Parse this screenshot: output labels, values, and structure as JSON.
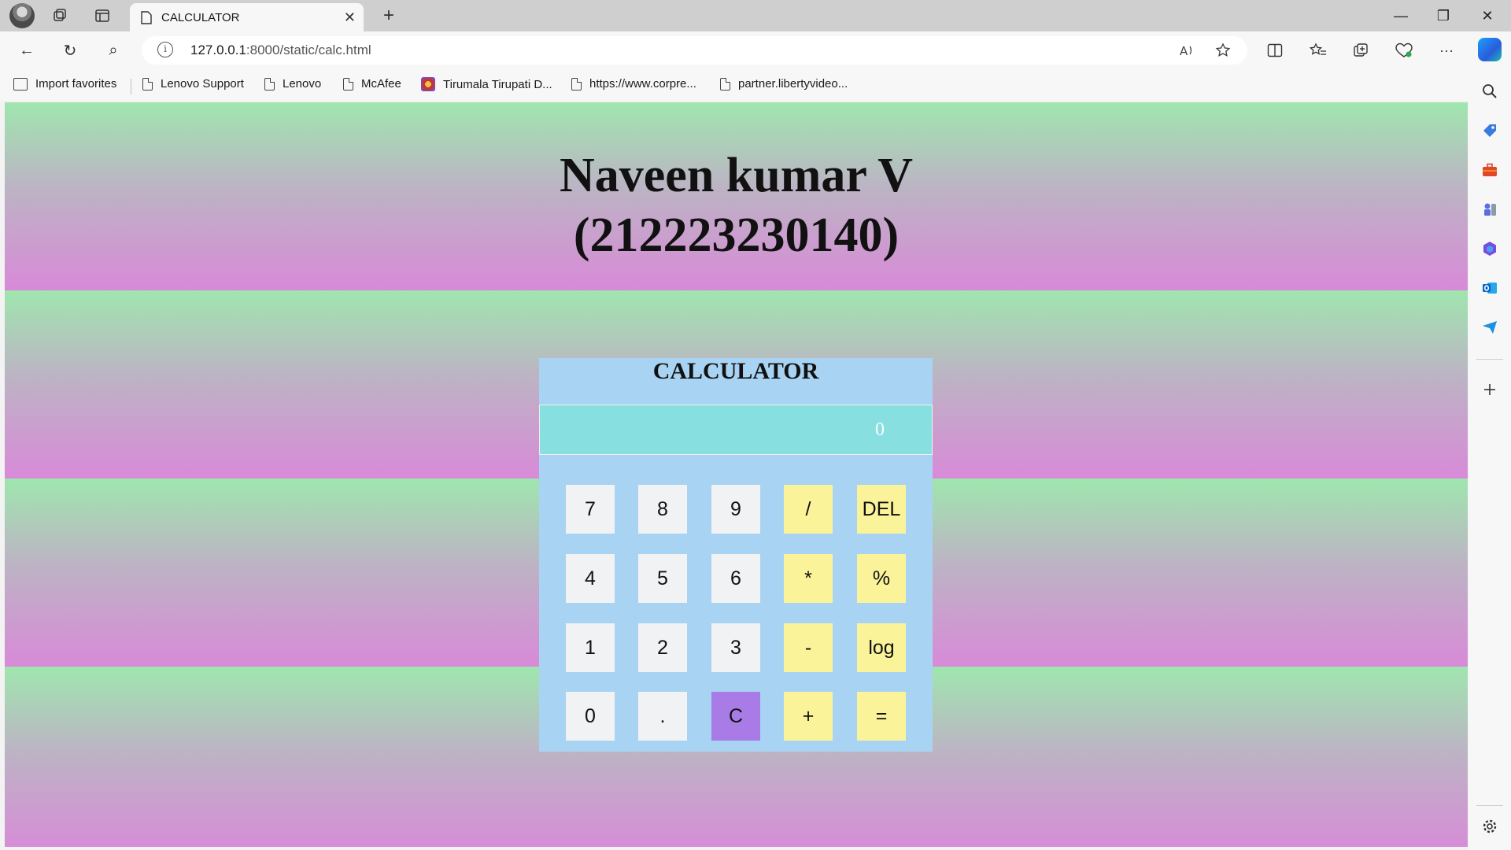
{
  "browser": {
    "tab_title": "CALCULATOR",
    "tab_close": "✕",
    "new_tab": "+",
    "url_host": "127.0.0.1",
    "url_rest": ":8000/static/calc.html",
    "minimize": "—",
    "restore": "❐",
    "close": "✕",
    "back": "←",
    "refresh": "↻",
    "search": "⌕",
    "more": "···",
    "info": "i"
  },
  "favorites": [
    {
      "label": "Import favorites",
      "icon": "import-icon"
    },
    {
      "label": "Lenovo Support",
      "icon": "page-icon"
    },
    {
      "label": "Lenovo",
      "icon": "page-icon"
    },
    {
      "label": "McAfee",
      "icon": "page-icon"
    },
    {
      "label": "Tirumala Tirupati D...",
      "icon": "site-icon"
    },
    {
      "label": "https://www.corpre...",
      "icon": "page-icon"
    },
    {
      "label": "partner.libertyvideo...",
      "icon": "page-icon"
    }
  ],
  "page": {
    "title_line1": "Naveen kumar V",
    "title_line2": "(212223230140)"
  },
  "calculator": {
    "title": "CALCULATOR",
    "display": "0",
    "keys": [
      [
        "7",
        "8",
        "9",
        "/",
        "DEL"
      ],
      [
        "4",
        "5",
        "6",
        "*",
        "%"
      ],
      [
        "1",
        "2",
        "3",
        "-",
        "log"
      ],
      [
        "0",
        ".",
        "C",
        "+",
        "="
      ]
    ]
  },
  "colors": {
    "gradient_top": "#9fe6ae",
    "gradient_bottom": "#d88ad8",
    "calc_bg": "#a9d3f2",
    "display_bg": "#88dfe0",
    "number_key": "#f1f2f3",
    "operator_key": "#fbf39a",
    "clear_key": "#a87be6"
  }
}
